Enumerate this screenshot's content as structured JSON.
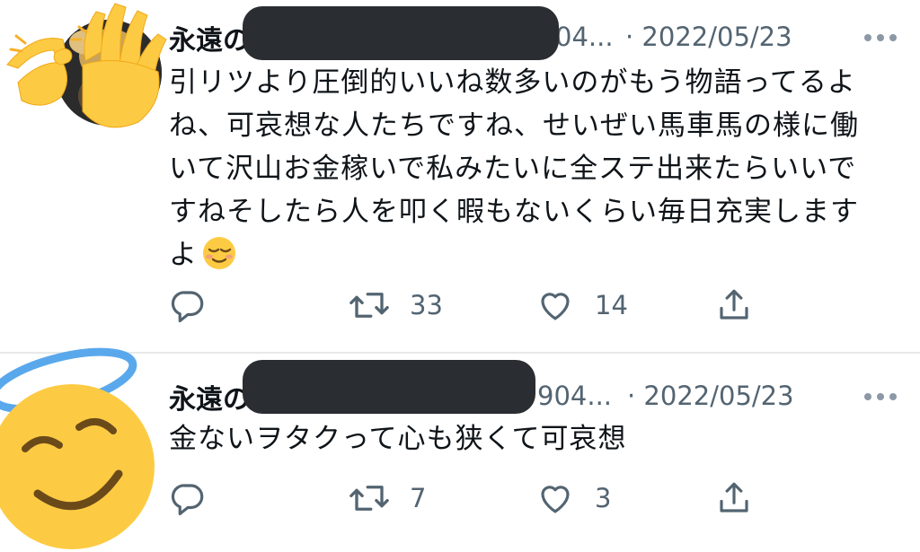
{
  "tweets": [
    {
      "name": "永遠の",
      "handle_fragment": "04...",
      "date": "· 2022/05/23",
      "text": "引リツより圧倒的いいね数多いのがもう物語ってるよね、可哀想な人たちですね、せいぜい馬車馬の様に働いて沢山お金稼いで私みたいに全ステ出来たらいいですねそしたら人を叩く暇もないくらい毎日充実しますよ",
      "text_emoji": "relieved-face",
      "retweets": "33",
      "likes": "14"
    },
    {
      "name": "永遠の",
      "handle_fragment": "904...",
      "date": "· 2022/05/23",
      "text": "金ないヲタクって心も狭くて可哀想",
      "retweets": "7",
      "likes": "3"
    }
  ],
  "icons": {
    "reply": "reply-icon",
    "retweet": "retweet-icon",
    "like": "heart-icon",
    "share": "share-icon",
    "more": "more-dots-icon"
  },
  "colors": {
    "text": "#0f1419",
    "secondary": "#536471",
    "divider": "#e7e9ea",
    "redaction": "#2a2d31",
    "emoji_yellow": "#fdcb43",
    "halo_blue": "#5aa8ec"
  }
}
